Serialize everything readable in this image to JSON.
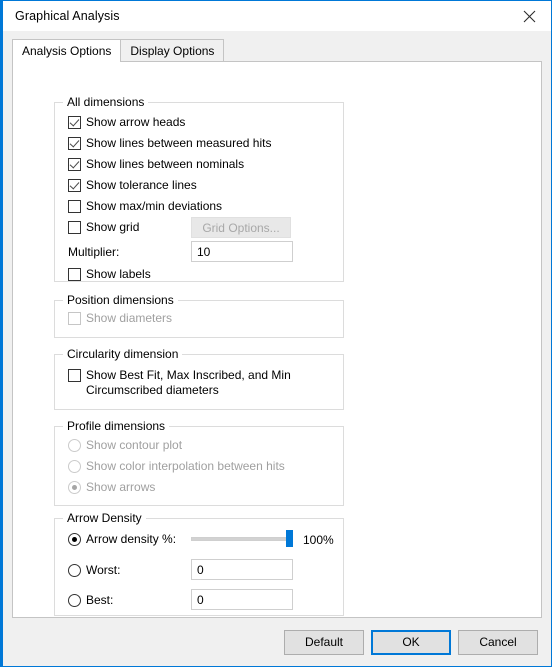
{
  "window": {
    "title": "Graphical Analysis",
    "close_icon": "close-icon"
  },
  "tabs": [
    {
      "label": "Analysis Options",
      "active": true
    },
    {
      "label": "Display Options",
      "active": false
    }
  ],
  "groups": {
    "all_dimensions": {
      "title": "All dimensions",
      "checkboxes": [
        {
          "label": "Show arrow heads",
          "checked": true,
          "enabled": true
        },
        {
          "label": "Show lines between measured hits",
          "checked": true,
          "enabled": true
        },
        {
          "label": "Show lines between nominals",
          "checked": true,
          "enabled": true
        },
        {
          "label": "Show tolerance lines",
          "checked": true,
          "enabled": true
        },
        {
          "label": "Show max/min deviations",
          "checked": false,
          "enabled": true
        },
        {
          "label": "Show grid",
          "checked": false,
          "enabled": true
        },
        {
          "label": "Show labels",
          "checked": false,
          "enabled": true
        }
      ],
      "grid_options_button": "Grid Options...",
      "multiplier_label": "Multiplier:",
      "multiplier_value": "10"
    },
    "position_dimensions": {
      "title": "Position dimensions",
      "show_diameters": "Show diameters"
    },
    "circularity_dimension": {
      "title": "Circularity dimension",
      "show_best_fit": "Show Best Fit, Max Inscribed, and Min Circumscribed diameters"
    },
    "profile_dimensions": {
      "title": "Profile dimensions",
      "radios": [
        {
          "label": "Show contour plot",
          "selected": false
        },
        {
          "label": "Show color interpolation between hits",
          "selected": false
        },
        {
          "label": "Show arrows",
          "selected": true
        }
      ]
    },
    "arrow_density": {
      "title": "Arrow Density",
      "density_radio_label": "Arrow density %:",
      "density_value": "100%",
      "slider_percent": 100,
      "worst_label": "Worst:",
      "worst_value": "0",
      "best_label": "Best:",
      "best_value": "0"
    }
  },
  "footer": {
    "default_label": "Default",
    "ok_label": "OK",
    "cancel_label": "Cancel"
  },
  "colors": {
    "accent": "#0078d7",
    "dialog_bg": "#f0f0f0",
    "page_bg": "#ffffff"
  }
}
